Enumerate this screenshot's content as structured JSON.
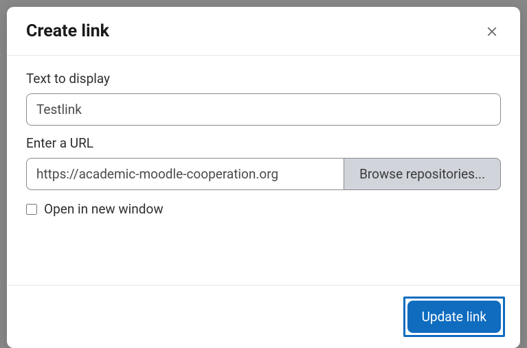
{
  "header": {
    "title": "Create link"
  },
  "form": {
    "textToDisplay": {
      "label": "Text to display",
      "value": "Testlink"
    },
    "url": {
      "label": "Enter a URL",
      "value": "https://academic-moodle-cooperation.org",
      "browseLabel": "Browse repositories..."
    },
    "newWindow": {
      "label": "Open in new window"
    }
  },
  "footer": {
    "updateLabel": "Update link"
  }
}
